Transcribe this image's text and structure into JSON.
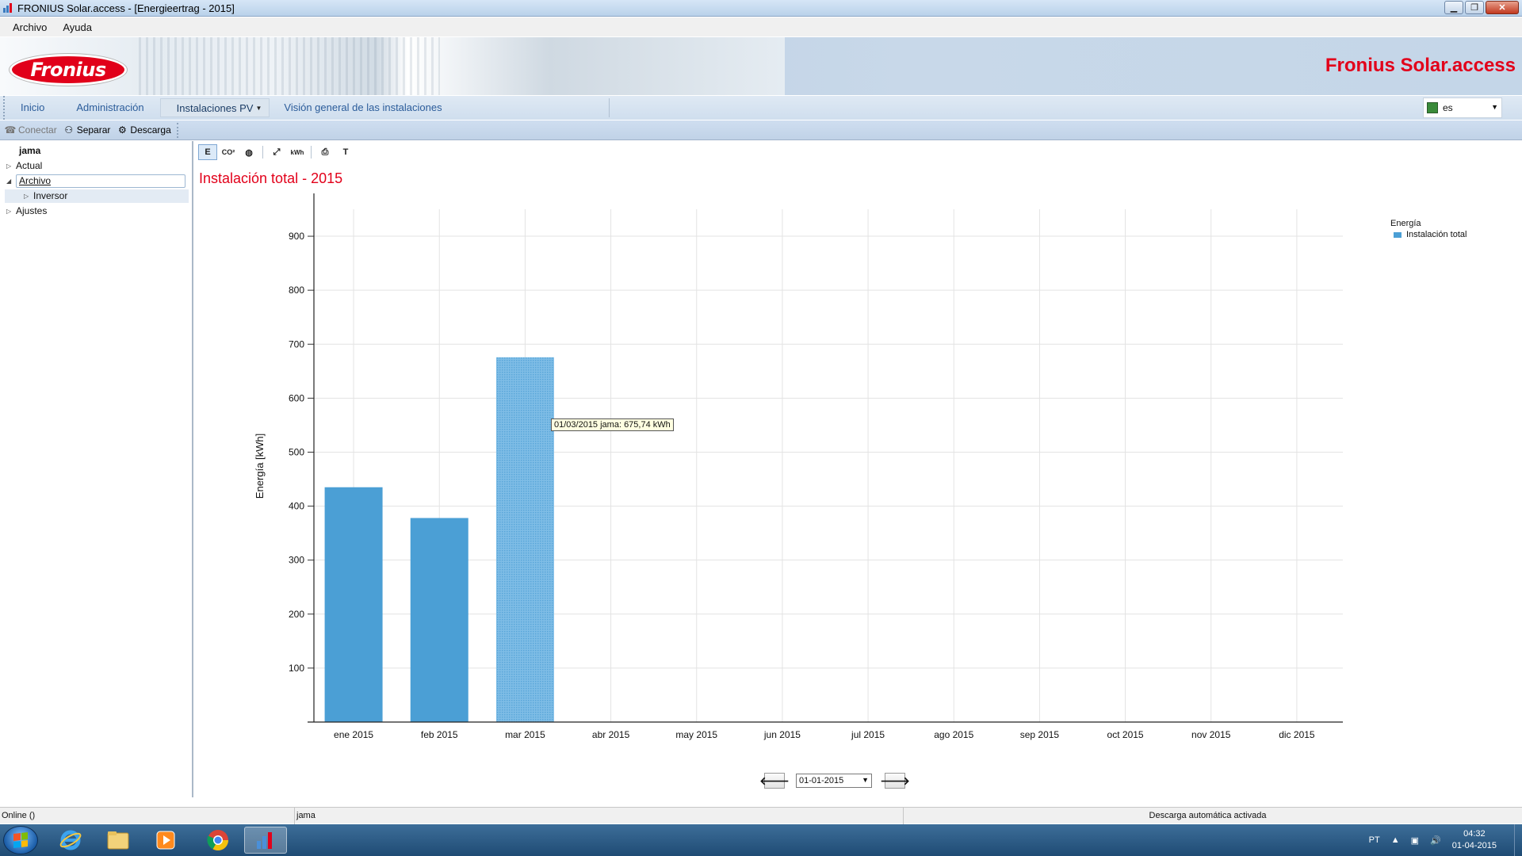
{
  "window": {
    "title": "FRONIUS Solar.access - [Energieertrag - 2015]"
  },
  "menu": {
    "items": [
      "Archivo",
      "Ayuda"
    ]
  },
  "banner": {
    "logo_text": "Fronius",
    "brand_title": "Fronius Solar.access"
  },
  "nav": {
    "tabs": [
      "Inicio",
      "Administración",
      "Instalaciones PV",
      "Visión general de las instalaciones"
    ],
    "active_tab": "Instalaciones PV",
    "language": "es"
  },
  "toolbar": {
    "connect": "Conectar",
    "separate": "Separar",
    "download": "Descarga"
  },
  "tree": {
    "root": "jama",
    "actual": "Actual",
    "archivo": "Archivo",
    "inversor": "Inversor",
    "ajustes": "Ajustes"
  },
  "chart_tools": {
    "e_label": "E",
    "co2_label": "CO²",
    "kwh_label": "kWh",
    "t_label": "T"
  },
  "chart_data": {
    "type": "bar",
    "title": "Instalación total - 2015",
    "ylabel": "Energía [kWh]",
    "xlabel": "",
    "categories": [
      "ene 2015",
      "feb 2015",
      "mar 2015",
      "abr 2015",
      "may 2015",
      "jun 2015",
      "jul 2015",
      "ago 2015",
      "sep 2015",
      "oct 2015",
      "nov 2015",
      "dic 2015"
    ],
    "series": [
      {
        "name": "Instalación total",
        "values": [
          435,
          378,
          675.74,
          null,
          null,
          null,
          null,
          null,
          null,
          null,
          null,
          null
        ]
      }
    ],
    "highlighted_index": 2,
    "ylim": [
      0,
      950
    ],
    "yticks": [
      100,
      200,
      300,
      400,
      500,
      600,
      700,
      800,
      900
    ],
    "grid": true,
    "legend_title": "Energía",
    "legend_position": "top-right",
    "bar_color": "#4b9fd5",
    "tooltip": "01/03/2015 jama: 675,74 kWh"
  },
  "date_nav": {
    "value": "01-01-2015"
  },
  "status": {
    "left": "Online ()",
    "middle": "jama",
    "right": "Descarga automática activada"
  },
  "taskbar": {
    "lang": "PT",
    "time": "04:32",
    "date": "01-04-2015"
  }
}
